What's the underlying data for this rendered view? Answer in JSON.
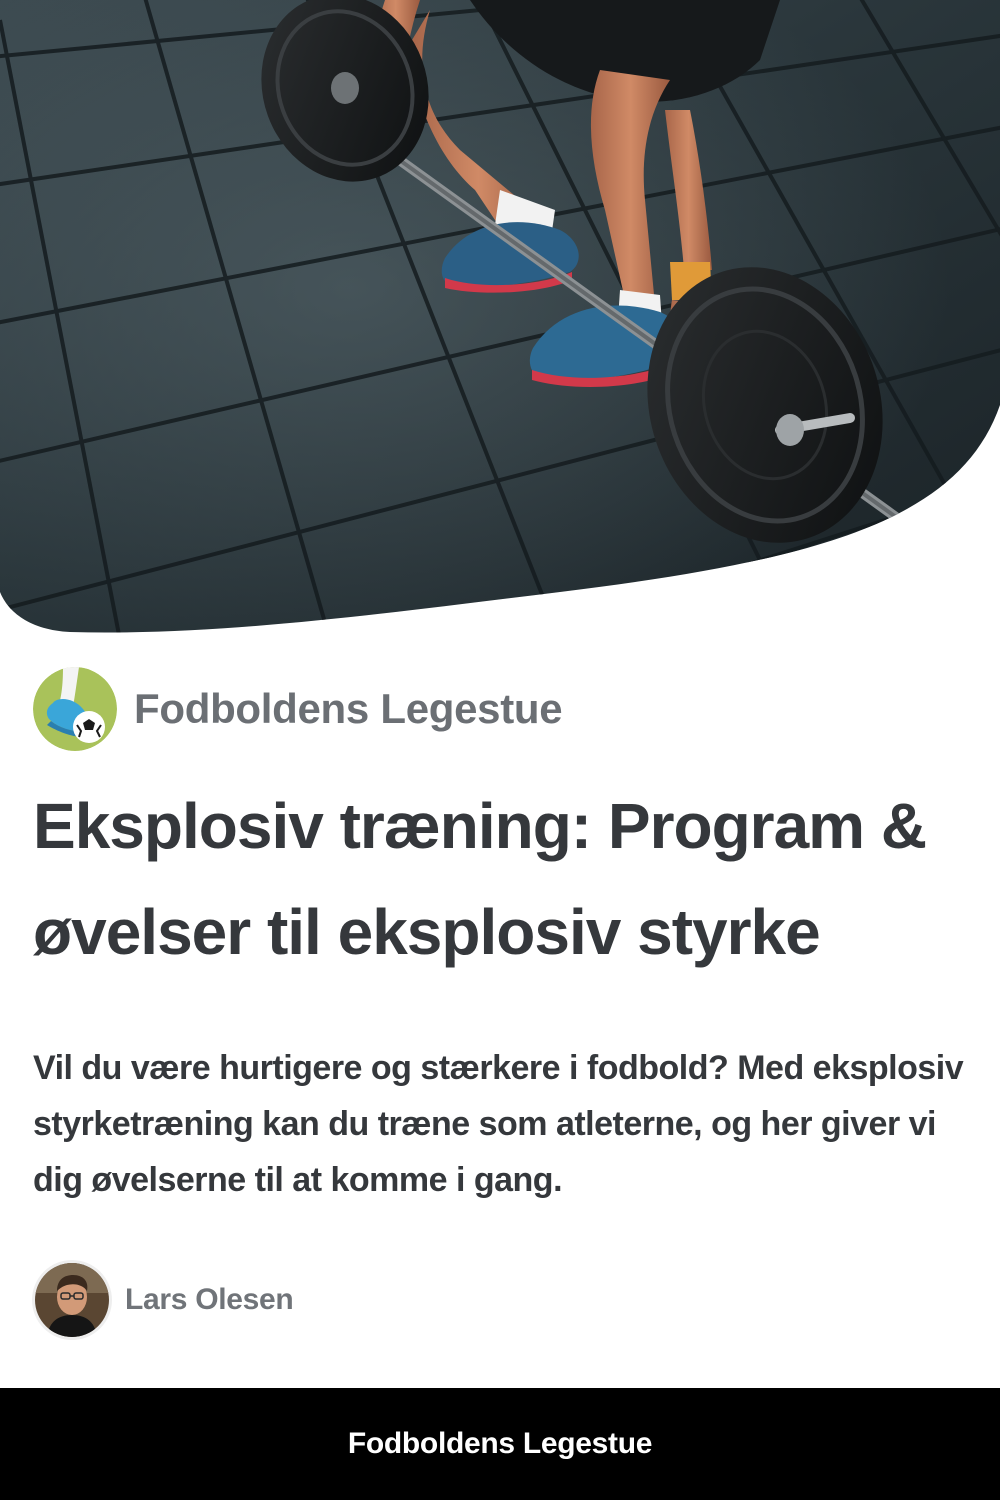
{
  "publisher": {
    "name": "Fodboldens Legestue",
    "logo_icon": "football-boot-ball-icon"
  },
  "article": {
    "headline": "Eksplosiv træning: Program & øvelser til eksplosiv styrke",
    "excerpt": "Vil du være hurtigere og stærkere i fodbold? Med eksplosiv styrketræning kan du træne som atleterne, og her giver vi dig øvelserne til at komme i gang.",
    "hero_image": "barbell-deadlift-gym-photo"
  },
  "author": {
    "name": "Lars Olesen",
    "avatar_icon": "author-portrait-icon"
  },
  "footer": {
    "title": "Fodboldens Legestue"
  },
  "colors": {
    "text_dark": "#35383c",
    "text_muted": "#6b6f74",
    "footer_bg": "#000000",
    "logo_green": "#a9c25a"
  }
}
